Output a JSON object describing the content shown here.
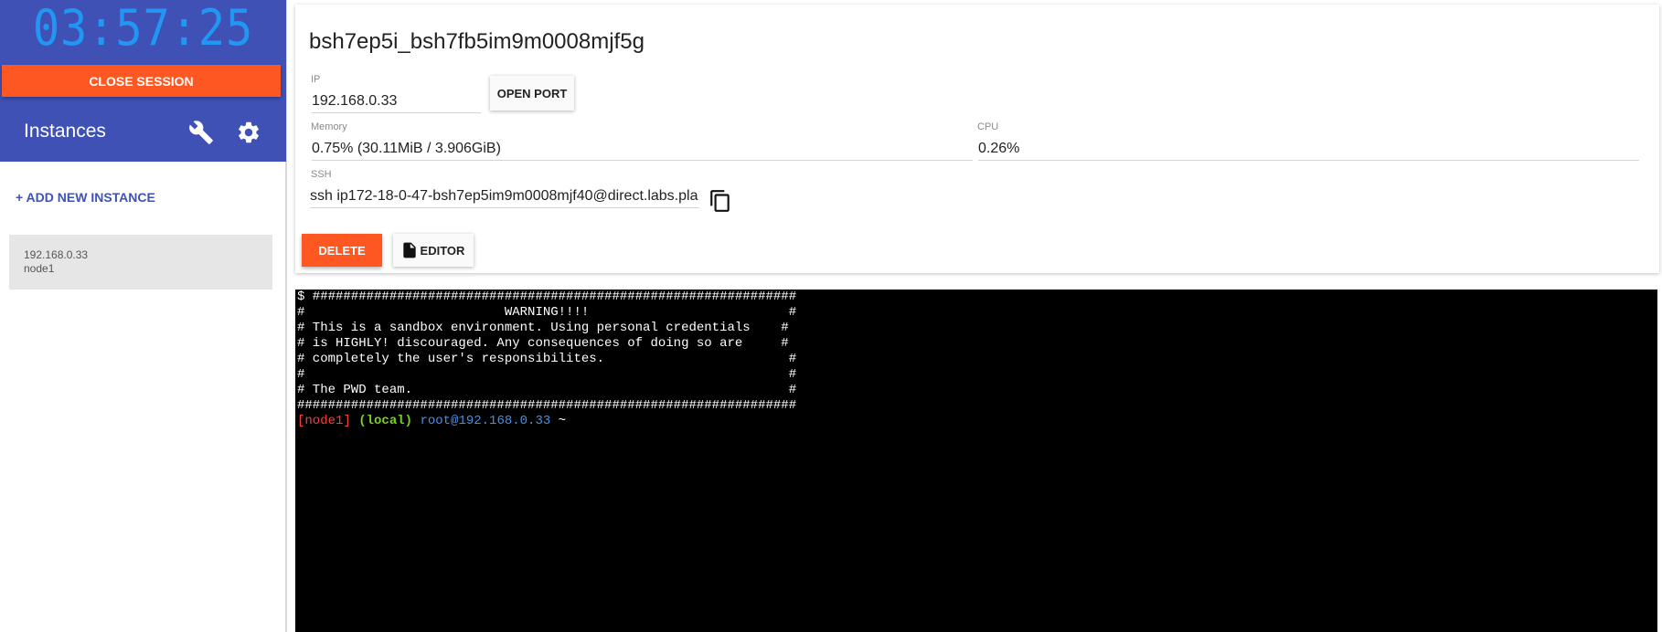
{
  "sidebar": {
    "timer": "03:57:25",
    "close_session_label": "CLOSE SESSION",
    "instances_title": "Instances",
    "add_instance_label": "+ ADD NEW INSTANCE",
    "instances": [
      {
        "ip": "192.168.0.33",
        "name": "node1"
      }
    ]
  },
  "panel": {
    "session_title": "bsh7ep5i_bsh7fb5im9m0008mjf5g",
    "ip_label": "IP",
    "ip_value": "192.168.0.33",
    "open_port_label": "OPEN PORT",
    "memory_label": "Memory",
    "memory_value": "0.75% (30.11MiB / 3.906GiB)",
    "cpu_label": "CPU",
    "cpu_value": "0.26%",
    "ssh_label": "SSH",
    "ssh_value": "ssh ip172-18-0-47-bsh7ep5im9m0008mjf40@direct.labs.pla",
    "delete_label": "DELETE",
    "editor_label": "EDITOR"
  },
  "terminal": {
    "lines": [
      "$ ###############################################################",
      "#                          WARNING!!!!                          #",
      "# This is a sandbox environment. Using personal credentials    #",
      "# is HIGHLY! discouraged. Any consequences of doing so are     #",
      "# completely the user's responsibilites.                        #",
      "#                                                               #",
      "# The PWD team.                                                 #",
      "#################################################################"
    ],
    "prompt": {
      "node": "[node1]",
      "local": "(local)",
      "user": "root@192.168.0.33",
      "tilde": "~"
    }
  },
  "colors": {
    "header_bg": "#3f51b5",
    "timer": "#2196f3",
    "accent": "#ff5722",
    "terminal_bg": "#000000"
  }
}
